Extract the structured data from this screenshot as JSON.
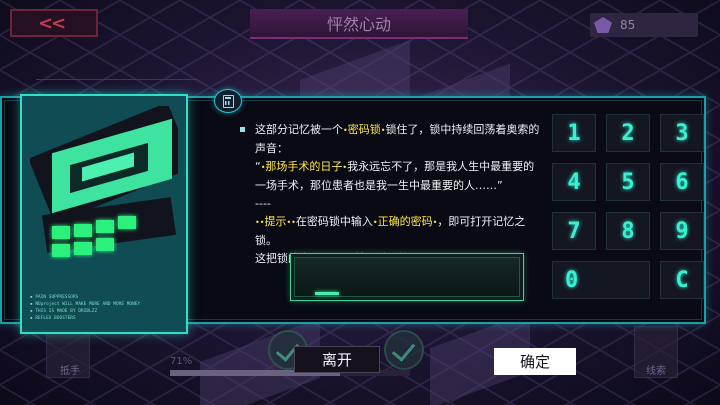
{
  "background": {
    "back_glyph": "<<",
    "title": "怦然心动",
    "currency_value": "85",
    "progress_label": "71%",
    "progress_value": 0.71,
    "side_left_label": "抵手",
    "side_right_label": "线索"
  },
  "card": {
    "notes": [
      "PAIN SUPPRESSORS",
      "NUproject WILL MAKE MORE AND MORE MONEY",
      "THIS IS MADE BY DRIBLZZ",
      "REFLEX BOOSTERS"
    ]
  },
  "description": {
    "line1_a": "这部分记忆被一个",
    "line1_hl": "密码锁",
    "line1_b": "锁住了，锁中持续回荡着奥索的",
    "line2": "声音：",
    "line3_open": "“",
    "line3_hl": "那场手术的日子",
    "line3_b": "我永远忘不了，那是我人生中最重要的",
    "line4": "一场手术，那位患者也是我一生中最重要的人……”",
    "line5": "----",
    "tip_label": "提示",
    "tip_a": "在密码锁中输入",
    "tip_hl": "正确的密码",
    "tip_b": "，即可打开记忆之锁。",
    "line7": "这把锁的密码似乎是某个重要的日期。"
  },
  "input": {
    "value": ""
  },
  "keypad": {
    "keys": [
      "1",
      "2",
      "3",
      "4",
      "5",
      "6",
      "7",
      "8",
      "9",
      "0",
      "C"
    ]
  },
  "buttons": {
    "leave": "离开",
    "confirm": "确定"
  },
  "colors": {
    "accent_cyan": "#2fe0c8",
    "highlight_yellow": "#ffe64a",
    "input_green": "#46f0a8"
  }
}
